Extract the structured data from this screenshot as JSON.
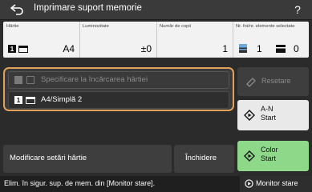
{
  "app": {
    "title": "Imprimare suport memorie",
    "back_icon": "back-arrow-icon",
    "help_label": "?"
  },
  "info": {
    "paper": {
      "label": "Hârtie",
      "value": "A4"
    },
    "brightness": {
      "label": "Luminozitate",
      "value": "±0"
    },
    "copies": {
      "label": "Număr de copii",
      "value": "1"
    },
    "pages": {
      "label": "Nr. foi/nr. elemente selectate",
      "sheets": "1",
      "elements": "0"
    }
  },
  "paper_panel": {
    "rows": [
      {
        "label": "Specificare la încărcarea hârtiei",
        "doc_num": ""
      },
      {
        "label": "A4/Simplă 2",
        "doc_num": "1"
      }
    ]
  },
  "buttons": {
    "reset": "Resetare",
    "bw_start_line1": "A-N",
    "bw_start_line2": "Start",
    "color_start_line1": "Color",
    "color_start_line2": "Start",
    "modify": "Modificare setări hârtie",
    "close": "Închidere"
  },
  "status": {
    "text": "Elim. în sigur. sup. de mem. din [Monitor stare].",
    "monitor": "Monitor stare"
  },
  "colors": {
    "accent_border": "#e2a15a",
    "color_start_bg": "#8ed88a",
    "bw_start_bg": "#e9e9e9"
  }
}
